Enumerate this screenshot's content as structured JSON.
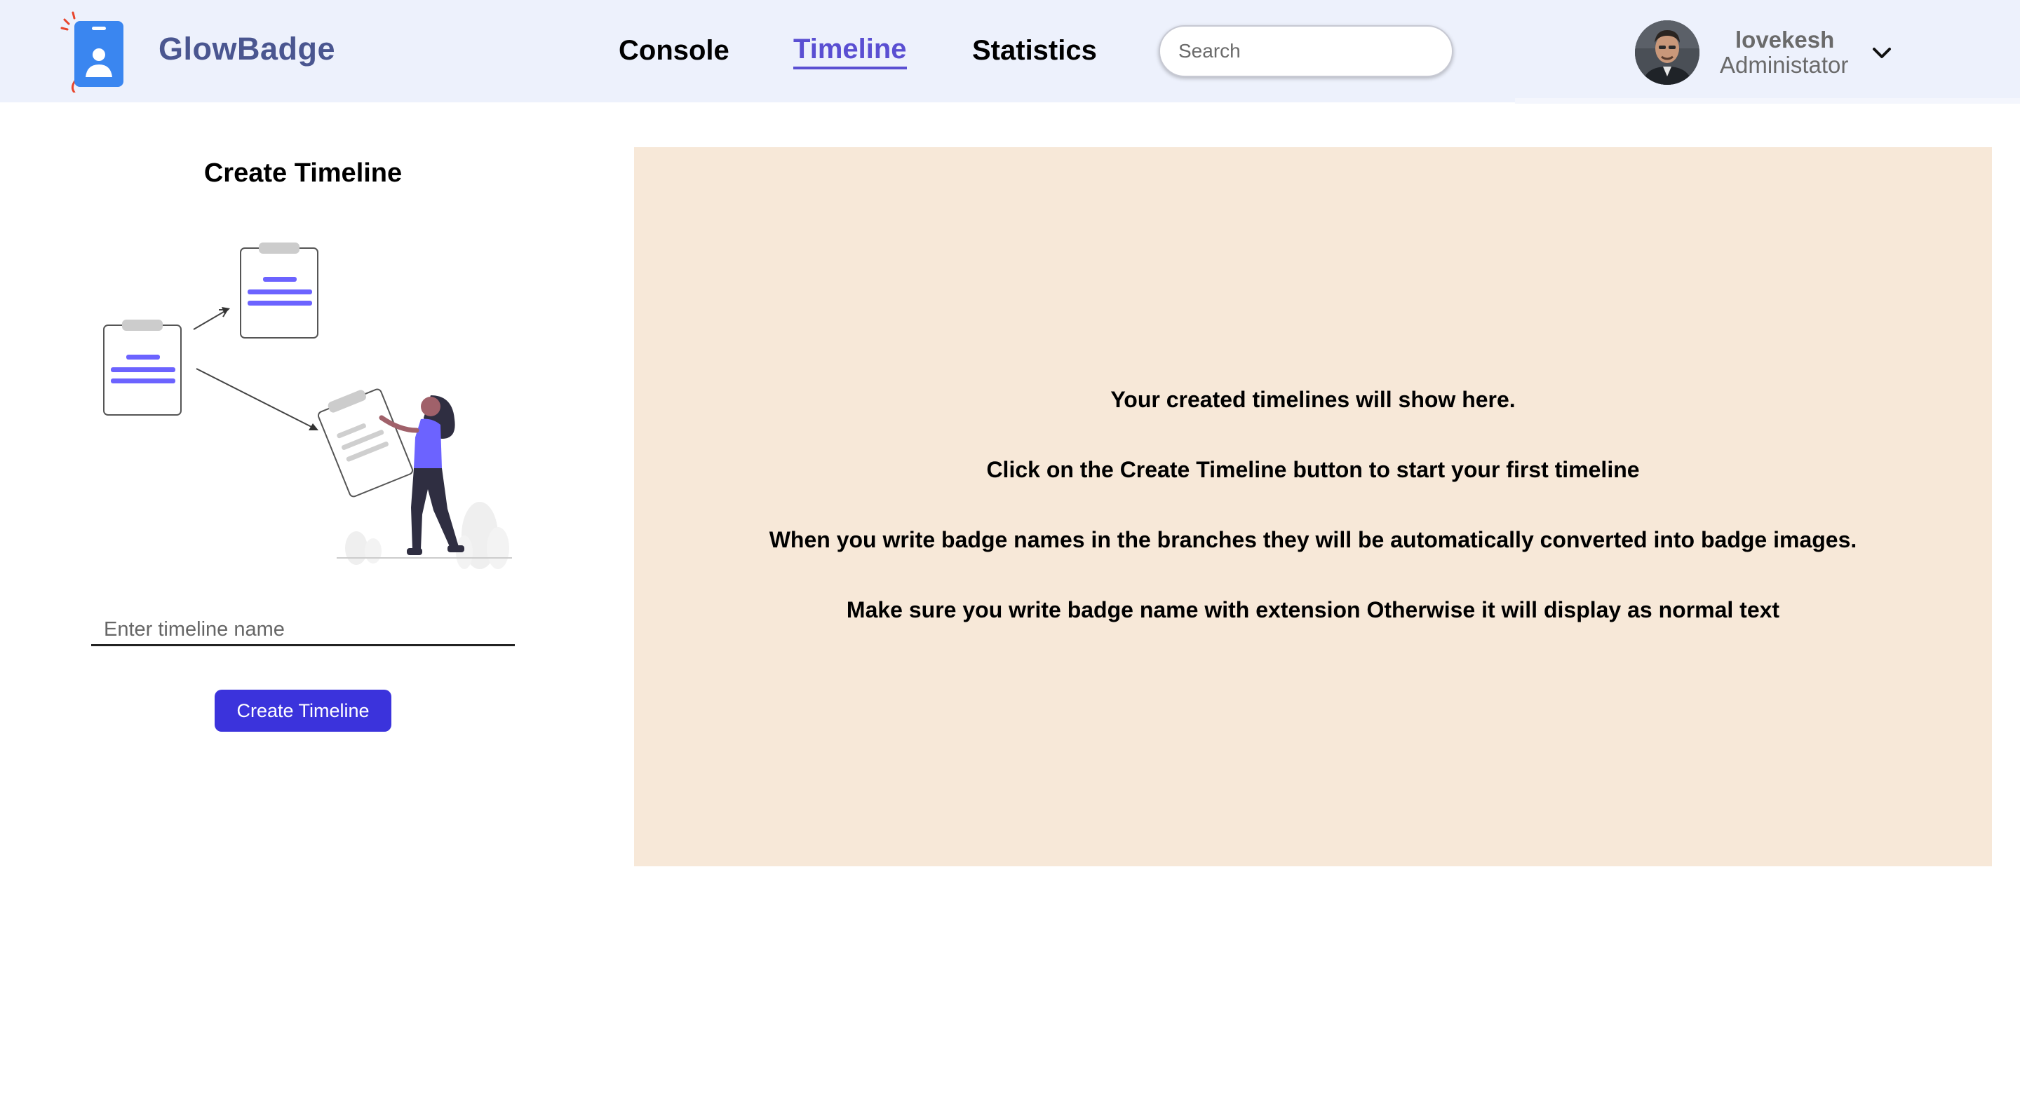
{
  "header": {
    "brand": "GlowBadge",
    "nav": {
      "console": "Console",
      "timeline": "Timeline",
      "statistics": "Statistics"
    },
    "active_nav": "Timeline",
    "search": {
      "placeholder": "Search",
      "value": ""
    },
    "user": {
      "name": "lovekesh",
      "role": "Administator"
    }
  },
  "create": {
    "title": "Create Timeline",
    "input": {
      "placeholder": "Enter timeline name",
      "value": ""
    },
    "button_label": "Create Timeline"
  },
  "panel": {
    "lines": [
      "Your created timelines will show here.",
      "Click on the Create Timeline button to start your first timeline",
      "When you write badge names in the branches they will be automatically converted into badge images.",
      "Make sure you write badge name with extension Otherwise it will display as normal text"
    ]
  },
  "colors": {
    "header_bg": "#edf1fc",
    "brand": "#4a5690",
    "accent": "#5a4fd2",
    "button": "#3b33dc",
    "panel_bg": "#f7e8d8",
    "logo": "#3a86f0"
  },
  "icons": [
    "badge-logo-icon",
    "chevron-down-icon"
  ]
}
